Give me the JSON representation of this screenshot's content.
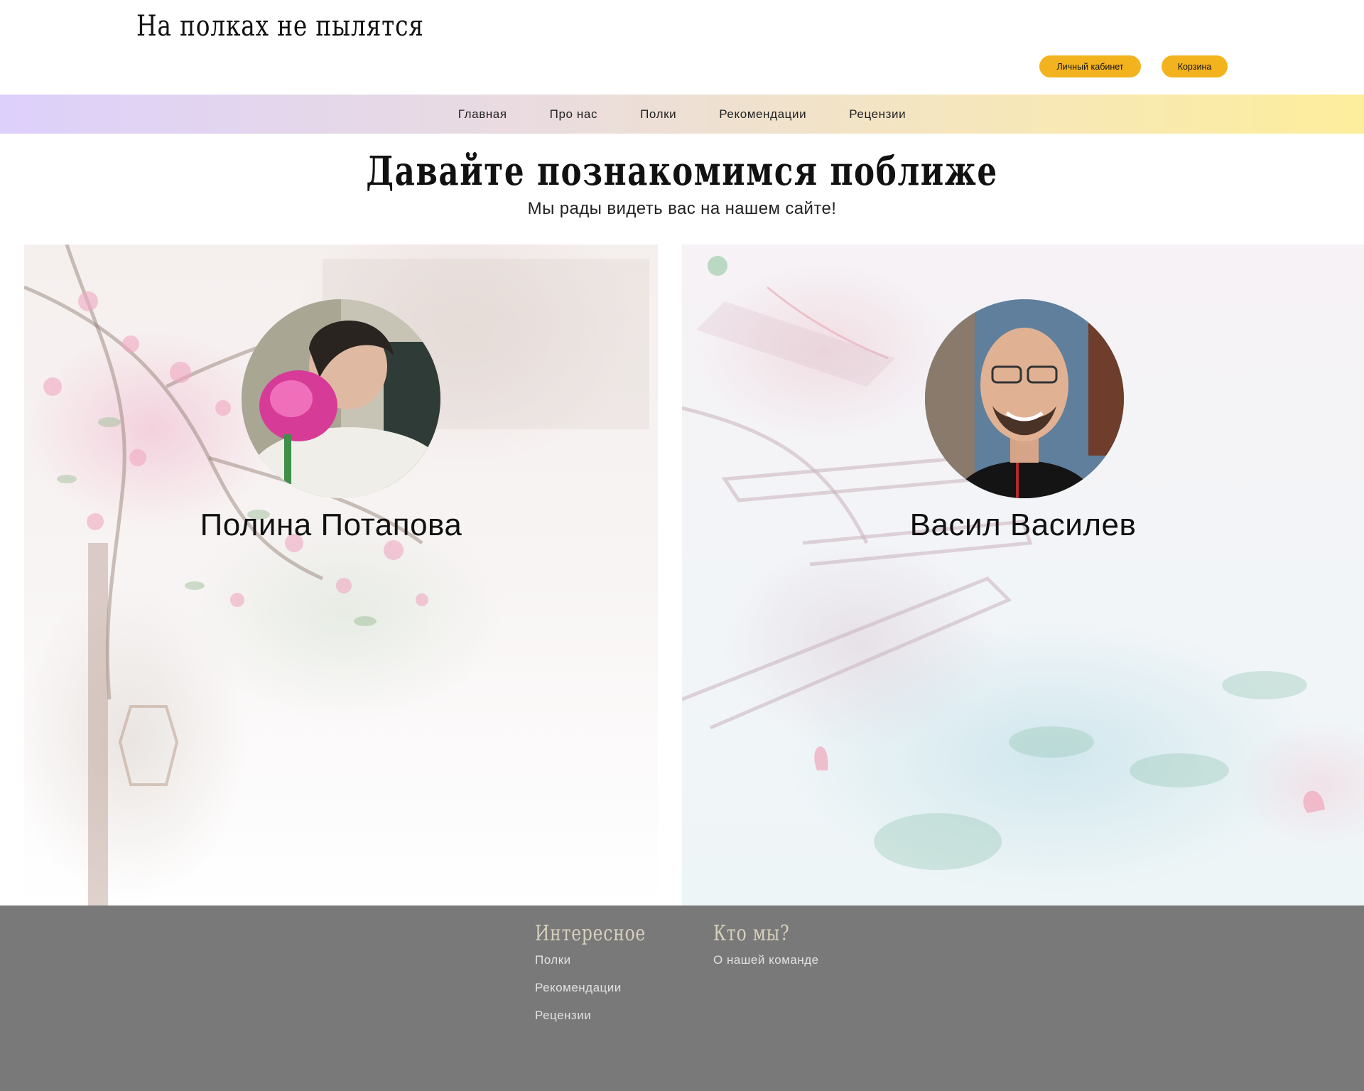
{
  "header": {
    "logo": "На полках не пылятся",
    "account_label": "Личный кабинет",
    "cart_label": "Корзина"
  },
  "nav": {
    "items": [
      {
        "label": "Главная"
      },
      {
        "label": "Про нас"
      },
      {
        "label": "Полки"
      },
      {
        "label": "Рекомендации"
      },
      {
        "label": "Рецензии"
      }
    ]
  },
  "hero": {
    "title": "Давайте познакомимся поближе",
    "subtitle": "Мы рады видеть вас на нашем сайте!"
  },
  "team": [
    {
      "name": "Полина Потапова"
    },
    {
      "name": "Васил Василев"
    }
  ],
  "footer": {
    "col1": {
      "title": "Интересное",
      "links": [
        "Полки",
        "Рекомендации",
        "Рецензии"
      ]
    },
    "col2": {
      "title": "Кто мы?",
      "links": [
        "О нашей команде"
      ]
    }
  },
  "colors": {
    "button": "#f3b31f",
    "footer_bg": "#797979",
    "footer_title": "#d8d0bd",
    "nav_gradient_start": "#ddd0fb",
    "nav_gradient_end": "#fdee9c"
  }
}
